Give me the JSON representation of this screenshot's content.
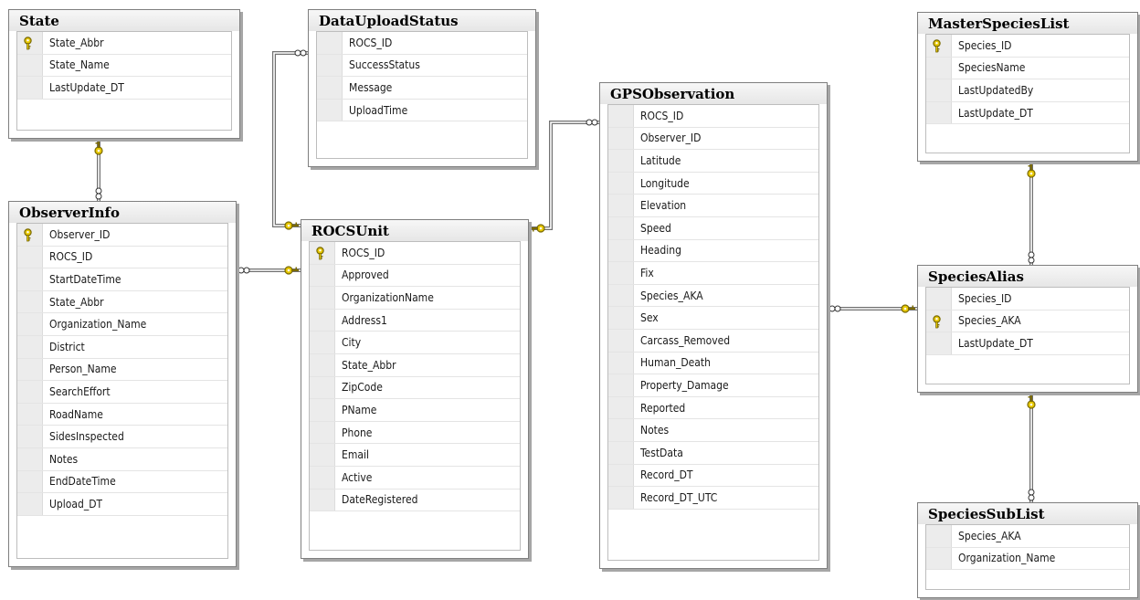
{
  "tables": [
    {
      "name": "State",
      "columns": [
        {
          "name": "State_Abbr",
          "pk": true
        },
        {
          "name": "State_Name",
          "pk": false
        },
        {
          "name": "LastUpdate_DT",
          "pk": false
        }
      ]
    },
    {
      "name": "DataUploadStatus",
      "columns": [
        {
          "name": "ROCS_ID",
          "pk": false
        },
        {
          "name": "SuccessStatus",
          "pk": false
        },
        {
          "name": "Message",
          "pk": false
        },
        {
          "name": "UploadTime",
          "pk": false
        }
      ]
    },
    {
      "name": "GPSObservation",
      "columns": [
        {
          "name": "ROCS_ID",
          "pk": false
        },
        {
          "name": "Observer_ID",
          "pk": false
        },
        {
          "name": "Latitude",
          "pk": false
        },
        {
          "name": "Longitude",
          "pk": false
        },
        {
          "name": "Elevation",
          "pk": false
        },
        {
          "name": "Speed",
          "pk": false
        },
        {
          "name": "Heading",
          "pk": false
        },
        {
          "name": "Fix",
          "pk": false
        },
        {
          "name": "Species_AKA",
          "pk": false
        },
        {
          "name": "Sex",
          "pk": false
        },
        {
          "name": "Carcass_Removed",
          "pk": false
        },
        {
          "name": "Human_Death",
          "pk": false
        },
        {
          "name": "Property_Damage",
          "pk": false
        },
        {
          "name": "Reported",
          "pk": false
        },
        {
          "name": "Notes",
          "pk": false
        },
        {
          "name": "TestData",
          "pk": false
        },
        {
          "name": "Record_DT",
          "pk": false
        },
        {
          "name": "Record_DT_UTC",
          "pk": false
        }
      ]
    },
    {
      "name": "MasterSpeciesList",
      "columns": [
        {
          "name": "Species_ID",
          "pk": true
        },
        {
          "name": "SpeciesName",
          "pk": false
        },
        {
          "name": "LastUpdatedBy",
          "pk": false
        },
        {
          "name": "LastUpdate_DT",
          "pk": false
        }
      ]
    },
    {
      "name": "ObserverInfo",
      "columns": [
        {
          "name": "Observer_ID",
          "pk": true
        },
        {
          "name": "ROCS_ID",
          "pk": false
        },
        {
          "name": "StartDateTime",
          "pk": false
        },
        {
          "name": "State_Abbr",
          "pk": false
        },
        {
          "name": "Organization_Name",
          "pk": false
        },
        {
          "name": "District",
          "pk": false
        },
        {
          "name": "Person_Name",
          "pk": false
        },
        {
          "name": "SearchEffort",
          "pk": false
        },
        {
          "name": "RoadName",
          "pk": false
        },
        {
          "name": "SidesInspected",
          "pk": false
        },
        {
          "name": "Notes",
          "pk": false
        },
        {
          "name": "EndDateTime",
          "pk": false
        },
        {
          "name": "Upload_DT",
          "pk": false
        }
      ]
    },
    {
      "name": "ROCSUnit",
      "columns": [
        {
          "name": "ROCS_ID",
          "pk": true
        },
        {
          "name": "Approved",
          "pk": false
        },
        {
          "name": "OrganizationName",
          "pk": false
        },
        {
          "name": "Address1",
          "pk": false
        },
        {
          "name": "City",
          "pk": false
        },
        {
          "name": "State_Abbr",
          "pk": false
        },
        {
          "name": "ZipCode",
          "pk": false
        },
        {
          "name": "PName",
          "pk": false
        },
        {
          "name": "Phone",
          "pk": false
        },
        {
          "name": "Email",
          "pk": false
        },
        {
          "name": "Active",
          "pk": false
        },
        {
          "name": "DateRegistered",
          "pk": false
        }
      ]
    },
    {
      "name": "SpeciesAlias",
      "columns": [
        {
          "name": "Species_ID",
          "pk": false
        },
        {
          "name": "Species_AKA",
          "pk": true
        },
        {
          "name": "LastUpdate_DT",
          "pk": false
        }
      ]
    },
    {
      "name": "SpeciesSubList",
      "columns": [
        {
          "name": "Species_AKA",
          "pk": false
        },
        {
          "name": "Organization_Name",
          "pk": false
        }
      ]
    }
  ],
  "relationships": [
    {
      "one": "State",
      "many": "ObserverInfo"
    },
    {
      "one": "ROCSUnit",
      "many": "DataUploadStatus"
    },
    {
      "one": "ROCSUnit",
      "many": "ObserverInfo"
    },
    {
      "one": "ROCSUnit",
      "many": "GPSObservation"
    },
    {
      "one": "MasterSpeciesList",
      "many": "SpeciesAlias"
    },
    {
      "one": "SpeciesAlias",
      "many": "GPSObservation"
    },
    {
      "one": "SpeciesAlias",
      "many": "SpeciesSubList"
    }
  ],
  "colors": {
    "key_icon": "#e8c800",
    "key_outline": "#7a6a00",
    "connector": "#707070"
  }
}
